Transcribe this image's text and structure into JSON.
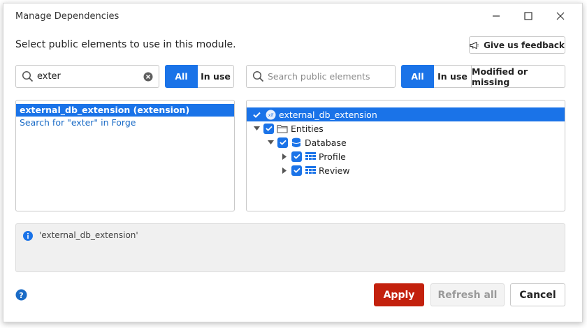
{
  "window": {
    "title": "Manage Dependencies"
  },
  "instructions": "Select public elements to use in this module.",
  "feedback_button": {
    "label": "Give us feedback",
    "icon": "megaphone-icon"
  },
  "left_search": {
    "value": "exter",
    "placeholder": ""
  },
  "left_filter": {
    "options": [
      "All",
      "In use"
    ],
    "selected": "All"
  },
  "right_search": {
    "value": "",
    "placeholder": "Search public elements"
  },
  "right_filter": {
    "options": [
      "All",
      "In use",
      "Modified or missing"
    ],
    "selected": "All"
  },
  "module_list": {
    "items": [
      {
        "label": "external_db_extension  (extension)",
        "selected": true
      },
      {
        "label": "Search for \"exter\" in Forge",
        "link": true
      }
    ]
  },
  "tree": {
    "nodes": [
      {
        "label": "external_db_extension",
        "icon": "extension-icon",
        "checked": true,
        "selected": true,
        "level": 0
      },
      {
        "label": "Entities",
        "icon": "folder-icon",
        "checked": true,
        "expanded": true,
        "level": 0
      },
      {
        "label": "Database",
        "icon": "database-icon",
        "checked": true,
        "expanded": true,
        "level": 1
      },
      {
        "label": "Profile",
        "icon": "entity-table-icon",
        "checked": true,
        "expanded": false,
        "level": 2
      },
      {
        "label": "Review",
        "icon": "entity-table-icon",
        "checked": true,
        "expanded": false,
        "level": 2
      }
    ]
  },
  "info_bar": {
    "text": "'external_db_extension'"
  },
  "footer": {
    "apply_label": "Apply",
    "refresh_label": "Refresh all",
    "cancel_label": "Cancel"
  },
  "colors": {
    "accent": "#1a73e8",
    "apply": "#c3210d",
    "link": "#1a6bc6"
  }
}
